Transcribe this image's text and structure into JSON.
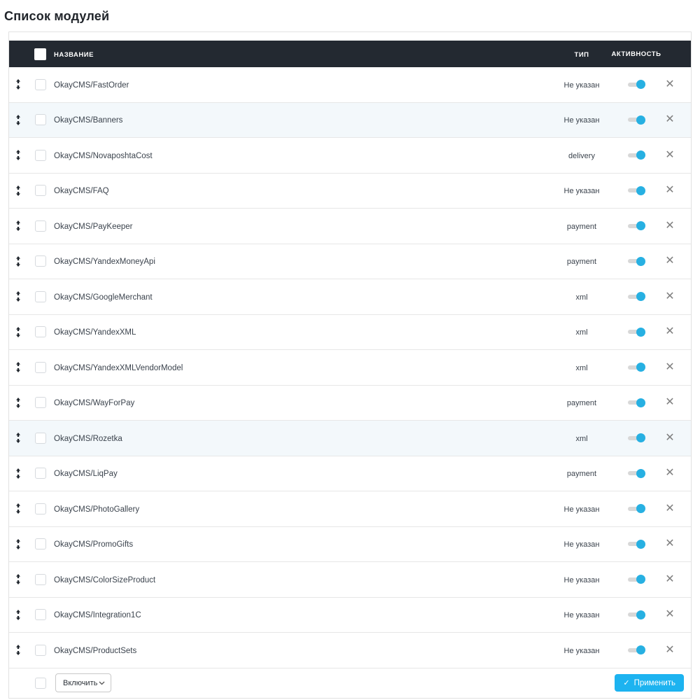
{
  "page": {
    "title": "Список модулей"
  },
  "table": {
    "columns": {
      "name": "НАЗВАНИЕ",
      "type": "ТИП",
      "activity": "АКТИВНОСТЬ"
    },
    "rows": [
      {
        "name": "OkayCMS/FastOrder",
        "type": "Не указан",
        "active": true,
        "highlighted": false
      },
      {
        "name": "OkayCMS/Banners",
        "type": "Не указан",
        "active": true,
        "highlighted": true
      },
      {
        "name": "OkayCMS/NovaposhtaCost",
        "type": "delivery",
        "active": true,
        "highlighted": false
      },
      {
        "name": "OkayCMS/FAQ",
        "type": "Не указан",
        "active": true,
        "highlighted": false
      },
      {
        "name": "OkayCMS/PayKeeper",
        "type": "payment",
        "active": true,
        "highlighted": false
      },
      {
        "name": "OkayCMS/YandexMoneyApi",
        "type": "payment",
        "active": true,
        "highlighted": false
      },
      {
        "name": "OkayCMS/GoogleMerchant",
        "type": "xml",
        "active": true,
        "highlighted": false
      },
      {
        "name": "OkayCMS/YandexXML",
        "type": "xml",
        "active": true,
        "highlighted": false
      },
      {
        "name": "OkayCMS/YandexXMLVendorModel",
        "type": "xml",
        "active": true,
        "highlighted": false
      },
      {
        "name": "OkayCMS/WayForPay",
        "type": "payment",
        "active": true,
        "highlighted": false
      },
      {
        "name": "OkayCMS/Rozetka",
        "type": "xml",
        "active": true,
        "highlighted": true
      },
      {
        "name": "OkayCMS/LiqPay",
        "type": "payment",
        "active": true,
        "highlighted": false
      },
      {
        "name": "OkayCMS/PhotoGallery",
        "type": "Не указан",
        "active": true,
        "highlighted": false
      },
      {
        "name": "OkayCMS/PromoGifts",
        "type": "Не указан",
        "active": true,
        "highlighted": false
      },
      {
        "name": "OkayCMS/ColorSizeProduct",
        "type": "Не указан",
        "active": true,
        "highlighted": false
      },
      {
        "name": "OkayCMS/Integration1C",
        "type": "Не указан",
        "active": true,
        "highlighted": false
      },
      {
        "name": "OkayCMS/ProductSets",
        "type": "Не указан",
        "active": true,
        "highlighted": false
      }
    ]
  },
  "footer": {
    "bulk_action_selected": "Включить",
    "apply_label": "Применить",
    "apply_check": "✓"
  },
  "icons": {
    "delete": "✕"
  },
  "colors": {
    "header_bg": "#232931",
    "accent_blue": "#1db3f0",
    "toggle_knob": "#27b0e2",
    "row_highlight": "#f3f8fb"
  }
}
